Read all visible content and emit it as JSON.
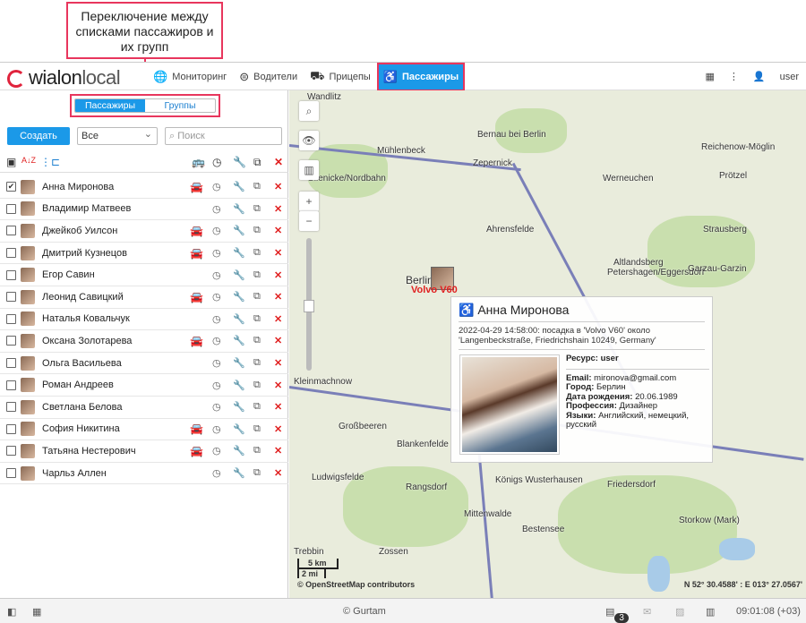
{
  "callout": "Переключение между списками пассажиров и их групп",
  "logo": {
    "a": "wialon",
    "b": "local"
  },
  "nav": [
    {
      "icon": "🌐",
      "label": "Мониторинг"
    },
    {
      "icon": "⊜",
      "label": "Водители"
    },
    {
      "icon": "⛟",
      "label": "Прицепы"
    },
    {
      "icon": "♿",
      "label": "Пассажиры"
    }
  ],
  "top_right": {
    "user": "user"
  },
  "segment": {
    "passengers": "Пассажиры",
    "groups": "Группы"
  },
  "controls": {
    "create": "Создать",
    "filter": "Все",
    "search_placeholder": "Поиск"
  },
  "passengers": [
    {
      "name": "Анна Миронова",
      "checked": true,
      "car": "dark"
    },
    {
      "name": "Владимир Матвеев",
      "checked": false,
      "car": ""
    },
    {
      "name": "Джейкоб Уилсон",
      "checked": false,
      "car": "yellow"
    },
    {
      "name": "Дмитрий Кузнецов",
      "checked": false,
      "car": "dark"
    },
    {
      "name": "Егор Савин",
      "checked": false,
      "car": ""
    },
    {
      "name": "Леонид Савицкий",
      "checked": false,
      "car": "yellow"
    },
    {
      "name": "Наталья Ковальчук",
      "checked": false,
      "car": ""
    },
    {
      "name": "Оксана Золотарева",
      "checked": false,
      "car": "dark"
    },
    {
      "name": "Ольга Васильева",
      "checked": false,
      "car": ""
    },
    {
      "name": "Роман Андреев",
      "checked": false,
      "car": ""
    },
    {
      "name": "Светлана Белова",
      "checked": false,
      "car": ""
    },
    {
      "name": "София Никитина",
      "checked": false,
      "car": "dark"
    },
    {
      "name": "Татьяна Нестерович",
      "checked": false,
      "car": "dark"
    },
    {
      "name": "Чарльз Аллен",
      "checked": false,
      "car": ""
    }
  ],
  "map": {
    "places": [
      "Wandlitz",
      "Bernau bei Berlin",
      "Mühlenbeck",
      "Zepernick",
      "Glienicke/Nordbahn",
      "Werneuchen",
      "Ahrensfelde",
      "Altlandsberg",
      "Berlin",
      "Petershagen/Eggersdorf",
      "Garzau-Garzin",
      "Kleinmachnow",
      "Großbeeren",
      "Blankenfelde",
      "Ludwigsfelde",
      "Rangsdorf",
      "Königs Wusterhausen",
      "Friedersdorf",
      "Mittenwalde",
      "Bestensee",
      "Storkow (Mark)",
      "Trebbin",
      "Zossen",
      "Strausberg",
      "Prötzel",
      "Reichenow-Möglin"
    ],
    "marker_label": "Volvo V60",
    "scale_km": "5 km",
    "scale_mi": "2 mi",
    "attribution": "© OpenStreetMap contributors",
    "coords": "N 52° 30.4588' : E 013° 27.0567'"
  },
  "popup": {
    "name": "Анна Миронова",
    "event": "2022-04-29 14:58:00: посадка в 'Volvo V60' около 'Langenbeckstraße, Friedrichshain 10249, Germany'",
    "resource_label": "Ресурс:",
    "resource": "user",
    "fields": [
      {
        "k": "Email:",
        "v": "mironova@gmail.com"
      },
      {
        "k": "Город:",
        "v": "Берлин"
      },
      {
        "k": "Дата рождения:",
        "v": "20.06.1989"
      },
      {
        "k": "Профессия:",
        "v": "Дизайнер"
      },
      {
        "k": "Языки:",
        "v": "Английский, немецкий, русский"
      }
    ]
  },
  "footer": {
    "copyright": "© Gurtam",
    "notifications": "3",
    "time": "09:01:08 (+03)"
  }
}
